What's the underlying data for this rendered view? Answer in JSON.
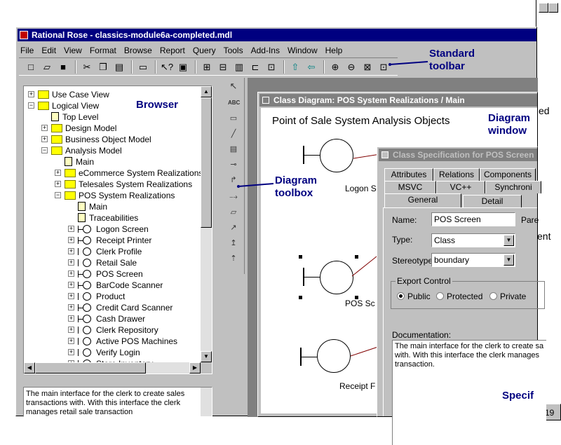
{
  "app": {
    "title": "Rational Rose - classics-module6a-completed.mdl",
    "menu": [
      "File",
      "Edit",
      "View",
      "Format",
      "Browse",
      "Report",
      "Query",
      "Tools",
      "Add-Ins",
      "Window",
      "Help"
    ]
  },
  "callouts": {
    "standard_toolbar": [
      "Standard",
      "toolbar"
    ],
    "browser": "Browser",
    "diagram_toolbox": [
      "Diagram",
      "toolbox"
    ],
    "diagram_window": [
      "Diagram",
      "window"
    ],
    "specification": "Specif"
  },
  "browser": {
    "items": [
      {
        "label": "Use Case View",
        "icon": "folder",
        "level": 0,
        "expander": "+"
      },
      {
        "label": "Logical View",
        "icon": "folder",
        "level": 0,
        "expander": "-"
      },
      {
        "label": "Top Level",
        "icon": "diagram",
        "level": 1,
        "expander": ""
      },
      {
        "label": "Design Model",
        "icon": "folder",
        "level": 1,
        "expander": "+"
      },
      {
        "label": "Business Object Model",
        "icon": "folder",
        "level": 1,
        "expander": "+"
      },
      {
        "label": "Analysis Model",
        "icon": "folder",
        "level": 1,
        "expander": "-"
      },
      {
        "label": "Main",
        "icon": "diagram",
        "level": 2,
        "expander": ""
      },
      {
        "label": "eCommerce System Realizations",
        "icon": "folder",
        "level": 2,
        "expander": "+"
      },
      {
        "label": "Telesales System Realizations",
        "icon": "folder",
        "level": 2,
        "expander": "+"
      },
      {
        "label": "POS System Realizations",
        "icon": "folder",
        "level": 2,
        "expander": "-"
      },
      {
        "label": "Main",
        "icon": "diagram",
        "level": 3,
        "expander": ""
      },
      {
        "label": "Traceabilities",
        "icon": "diagram",
        "level": 3,
        "expander": ""
      },
      {
        "label": "Logon Screen",
        "icon": "boundary",
        "level": 3,
        "expander": "+"
      },
      {
        "label": "Receipt Printer",
        "icon": "boundary",
        "level": 3,
        "expander": "+"
      },
      {
        "label": "Clerk Profile",
        "icon": "entity",
        "level": 3,
        "expander": "+"
      },
      {
        "label": "Retail Sale",
        "icon": "entity",
        "level": 3,
        "expander": "+"
      },
      {
        "label": "POS Screen",
        "icon": "boundary",
        "level": 3,
        "expander": "+"
      },
      {
        "label": "BarCode Scanner",
        "icon": "boundary",
        "level": 3,
        "expander": "+"
      },
      {
        "label": "Product",
        "icon": "entity",
        "level": 3,
        "expander": "+"
      },
      {
        "label": "Credit Card Scanner",
        "icon": "boundary",
        "level": 3,
        "expander": "+"
      },
      {
        "label": "Cash Drawer",
        "icon": "boundary",
        "level": 3,
        "expander": "+"
      },
      {
        "label": "Clerk Repository",
        "icon": "entity",
        "level": 3,
        "expander": "+"
      },
      {
        "label": "Active POS Machines",
        "icon": "entity",
        "level": 3,
        "expander": "+"
      },
      {
        "label": "Verify Login",
        "icon": "control",
        "level": 3,
        "expander": "+"
      },
      {
        "label": "Store Inventory",
        "icon": "entity",
        "level": 3,
        "expander": "+"
      }
    ],
    "doc_text": "The main interface for the clerk to create sales transactions with.  With this interface the clerk manages retail sale transaction"
  },
  "diagram": {
    "title": "Class Diagram: POS System Realizations / Main",
    "heading": "Point of Sale System Analysis Objects",
    "labels": {
      "logon": "Logon S",
      "pos": "POS Sc",
      "receipt": "Receipt F"
    }
  },
  "spec": {
    "title": "Class Specification for POS Screen",
    "tabs_row1": [
      "Attributes",
      "Relations",
      "Components"
    ],
    "tabs_row2": [
      "MSVC",
      "VC++",
      "Synchroni"
    ],
    "tabs_row3": [
      "General",
      "Detail"
    ],
    "name_label": "Name:",
    "name_value": "POS Screen",
    "parent_label": "Pare",
    "type_label": "Type:",
    "type_value": "Class",
    "stereotype_label": "Stereotype:",
    "stereotype_value": "boundary",
    "export_label": "Export Control",
    "export_options": [
      "Public",
      "Protected",
      "Private"
    ],
    "doc_label": "Documentation:",
    "doc_text": "The main interface for the clerk to create sa with.  With this interface the clerk manages transaction."
  },
  "background": {
    "right_frag1": "ed",
    "right_frag2": "ent",
    "status_num": "19"
  }
}
